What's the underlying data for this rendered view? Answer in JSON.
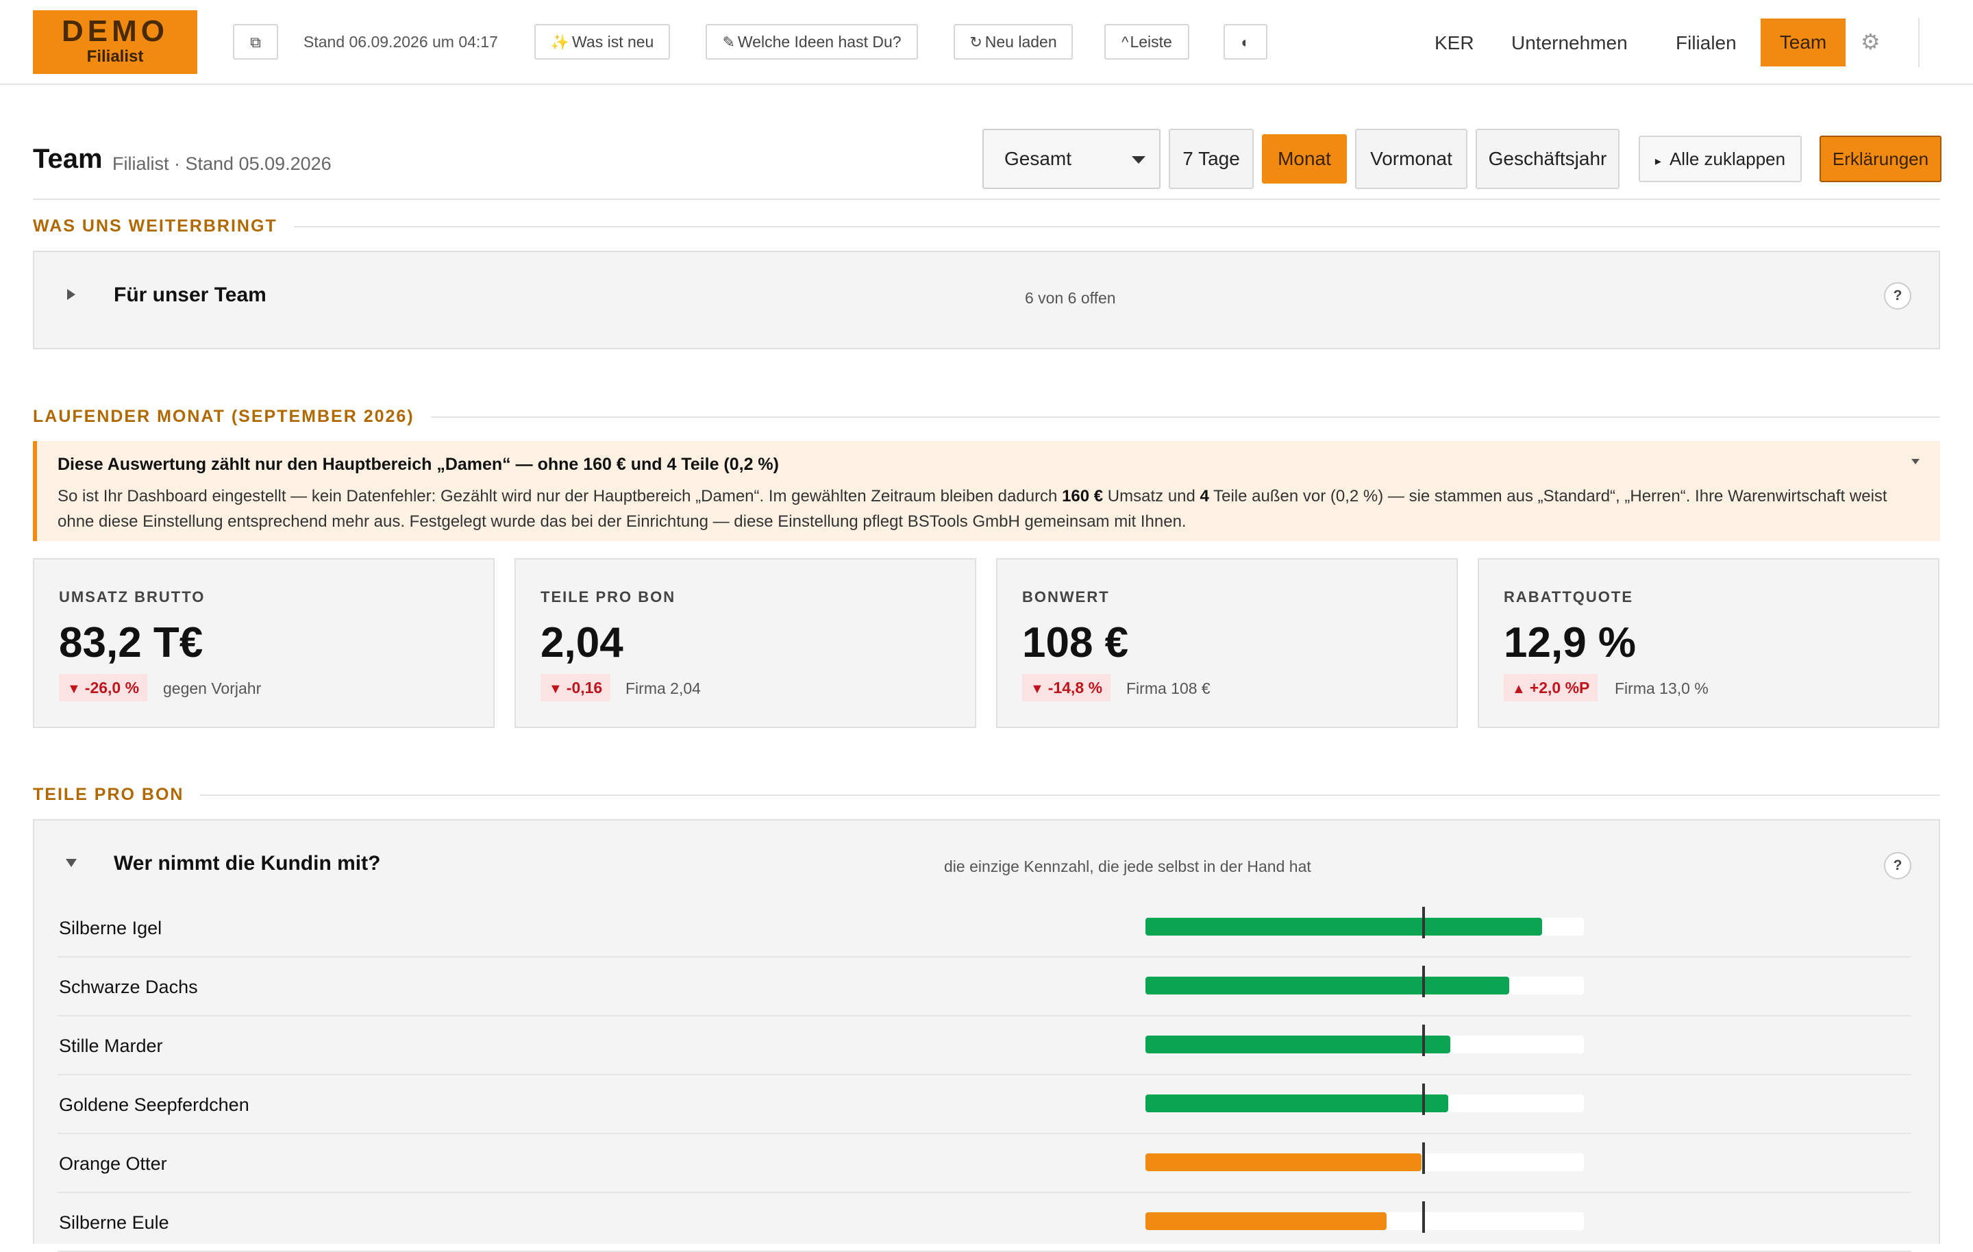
{
  "brand": {
    "line1": "DEMO",
    "line2": "Filialist"
  },
  "topbar": {
    "stand": "Stand 06.09.2026 um 04:17",
    "buttons": [
      {
        "icon": "⧉",
        "label": ""
      },
      {
        "icon": "✨",
        "label": "Was ist neu"
      },
      {
        "icon": "✎",
        "label": "Welche Ideen hast Du?"
      },
      {
        "icon": "↻",
        "label": "Neu laden"
      },
      {
        "icon": "^",
        "label": "Leiste"
      },
      {
        "icon": "◐",
        "label": ""
      }
    ],
    "nav": [
      "KER",
      "Unternehmen",
      "Filialen",
      "Team"
    ],
    "active_nav": "Team"
  },
  "header": {
    "title": "Team",
    "subtitle": "Filialist · Stand 05.09.2026",
    "select_value": "Gesamt",
    "periods": [
      "7 Tage",
      "Monat",
      "Vormonat",
      "Geschäftsjahr"
    ],
    "active_period": "Monat",
    "collapse_label": "Alle zuklappen",
    "collapse_icon": "▸",
    "explain_label": "Erklärungen"
  },
  "section1": {
    "heading": "WAS UNS WEITERBRINGT",
    "panel_title": "Für unser Team",
    "panel_meta": "6 von 6 offen",
    "help": "?"
  },
  "section2": {
    "heading": "LAUFENDER MONAT (SEPTEMBER 2026)",
    "notice_title": "Diese Auswertung zählt nur den Hauptbereich „Damen“ — ohne 160 € und 4 Teile (0,2 %)",
    "notice_body": {
      "t1": "So ist Ihr Dashboard eingestellt — kein Datenfehler: Gezählt wird nur der Hauptbereich „Damen“. Im gewählten Zeitraum bleiben dadurch ",
      "b1": "160 €",
      "t2": " Umsatz und ",
      "b2": "4",
      "t3": " Teile außen vor (0,2 %) — sie stammen aus „Standard“, „Herren“. Ihre Warenwirtschaft weist ohne diese Einstellung entsprechend mehr aus. Festgelegt wurde das bei der Einrichtung — diese Einstellung pflegt BSTools GmbH gemeinsam mit Ihnen."
    },
    "kpis": [
      {
        "label": "UMSATZ BRUTTO",
        "value": "83,2 T€",
        "arrow": "▼",
        "delta": "-26,0 %",
        "compare": "gegen Vorjahr"
      },
      {
        "label": "TEILE PRO BON",
        "value": "2,04",
        "arrow": "▼",
        "delta": "-0,16",
        "compare": "Firma 2,04"
      },
      {
        "label": "BONWERT",
        "value": "108 €",
        "arrow": "▼",
        "delta": "-14,8 %",
        "compare": "Firma 108 €"
      },
      {
        "label": "RABATTQUOTE",
        "value": "12,9 %",
        "arrow": "▲",
        "delta": "+2,0 %P",
        "compare": "Firma 13,0 %"
      }
    ]
  },
  "section3": {
    "heading": "TEILE PRO BON",
    "panel_title": "Wer nimmt die Kundin mit?",
    "panel_meta": "die einzige Kennzahl, die jede selbst in der Hand hat",
    "help": "?",
    "rows": [
      {
        "name": "Silberne Igel",
        "fill": 0.905,
        "color": "#0aa552"
      },
      {
        "name": "Schwarze Dachs",
        "fill": 0.83,
        "color": "#0aa552"
      },
      {
        "name": "Stille Marder",
        "fill": 0.695,
        "color": "#0aa552"
      },
      {
        "name": "Goldene Seepferdchen",
        "fill": 0.69,
        "color": "#0aa552"
      },
      {
        "name": "Orange Otter",
        "fill": 0.63,
        "color": "#f08a10"
      },
      {
        "name": "Silberne Eule",
        "fill": 0.55,
        "color": "#f08a10"
      }
    ],
    "reference": 0.635
  }
}
